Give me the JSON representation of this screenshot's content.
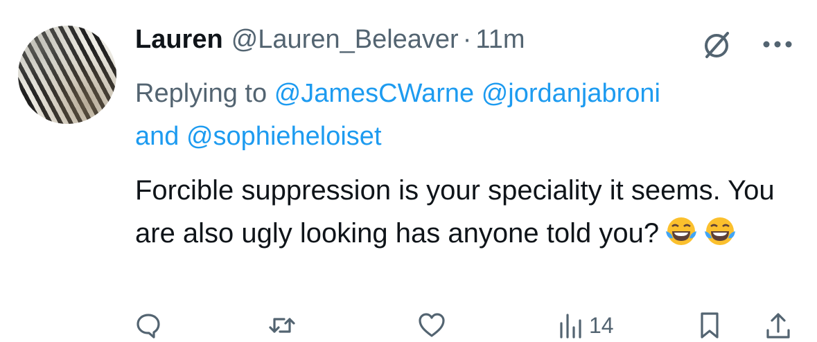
{
  "tweet": {
    "author_name": "Lauren",
    "handle": "@Lauren_Beleaver",
    "separator": "·",
    "time": "11m",
    "replying_prefix": "Replying to",
    "mention_1": "@JamesCWarne",
    "mention_2": "@jordanjabroni",
    "and_word": "and",
    "mention_3": "@sophieheloiset",
    "text": "Forcible suppression is your speciality it seems. You are also ugly looking has anyone told you?",
    "emojis": [
      "face-with-tears-of-joy",
      "face-with-tears-of-joy"
    ],
    "views": "14"
  },
  "colors": {
    "link": "#1d9bf0",
    "secondary_text": "#536471",
    "primary_text": "#0f1419"
  },
  "icons": [
    "grok-icon",
    "more-icon",
    "reply-icon",
    "retweet-icon",
    "like-icon",
    "views-icon",
    "bookmark-icon",
    "share-icon"
  ]
}
